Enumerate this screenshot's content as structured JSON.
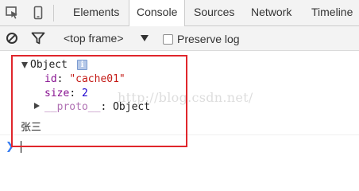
{
  "tabs": [
    {
      "label": "Elements",
      "active": false
    },
    {
      "label": "Console",
      "active": true
    },
    {
      "label": "Sources",
      "active": false
    },
    {
      "label": "Network",
      "active": false
    },
    {
      "label": "Timeline",
      "active": false
    }
  ],
  "toolbar": {
    "frame_select": "<top frame>",
    "preserve_log_label": "Preserve log",
    "preserve_log_checked": false
  },
  "console": {
    "object_label": "Object",
    "info_badge": "i",
    "props": [
      {
        "key": "id",
        "value": "\"cache01\"",
        "type": "string"
      },
      {
        "key": "size",
        "value": "2",
        "type": "number"
      }
    ],
    "proto_key": "__proto__",
    "proto_value": "Object",
    "log_text": "张三",
    "watermark": "http://blog.csdn.net/"
  },
  "colors": {
    "highlight_border": "#e0262c",
    "key": "#881391",
    "string": "#c41a16",
    "number": "#1c00cf",
    "prompt": "#367cf1"
  }
}
